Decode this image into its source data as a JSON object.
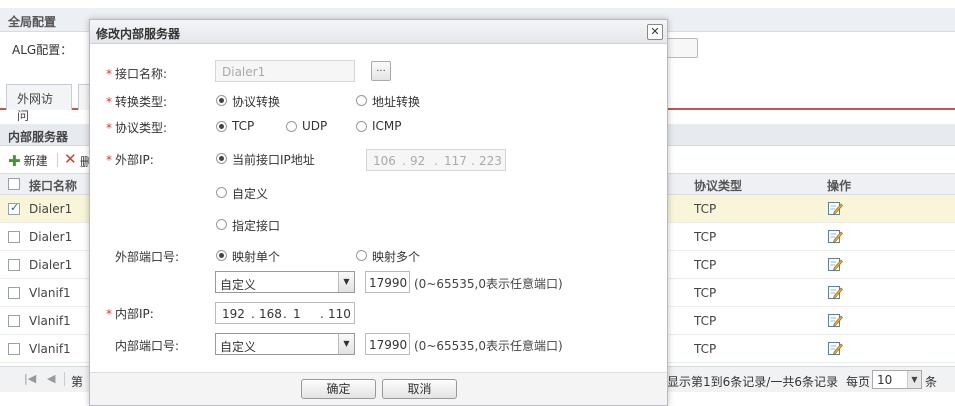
{
  "global": {
    "title": "全局配置",
    "alg_label": "ALG配置："
  },
  "tabs": [
    {
      "label": "外网访问"
    },
    {
      "label": ""
    }
  ],
  "panel": {
    "title": "内部服务器"
  },
  "toolbar": {
    "add_label": "新建",
    "delete_label": "删",
    "add_icon": "plus-icon",
    "delete_icon": "close-icon"
  },
  "table": {
    "headers": {
      "name": "接口名称",
      "protocol": "协议类型",
      "action": "操作"
    },
    "rows": [
      {
        "name": "Dialer1",
        "protocol": "TCP",
        "checked": true
      },
      {
        "name": "Dialer1",
        "protocol": "TCP",
        "checked": false
      },
      {
        "name": "Dialer1",
        "protocol": "TCP",
        "checked": false
      },
      {
        "name": "Vlanif1",
        "protocol": "TCP",
        "checked": false
      },
      {
        "name": "Vlanif1",
        "protocol": "TCP",
        "checked": false
      },
      {
        "name": "Vlanif1",
        "protocol": "TCP",
        "checked": false
      }
    ]
  },
  "pager": {
    "page_label": "第",
    "info": "显示第1到6条记录/一共6条记录",
    "per_page_label": "每页",
    "per_page_value": "10",
    "unit": "条"
  },
  "dialog": {
    "title": "修改内部服务器",
    "close_icon": "close-icon",
    "interface_name": {
      "label": "接口名称:",
      "placeholder": "Dialer1",
      "browse_label": "..."
    },
    "conversion_type": {
      "label": "转换类型:",
      "options": [
        {
          "label": "协议转换",
          "selected": true
        },
        {
          "label": "地址转换",
          "selected": false
        }
      ]
    },
    "protocol_type": {
      "label": "协议类型:",
      "options": [
        {
          "label": "TCP",
          "selected": true
        },
        {
          "label": "UDP",
          "selected": false
        },
        {
          "label": "ICMP",
          "selected": false
        }
      ]
    },
    "external_ip": {
      "label": "外部IP:",
      "options": [
        {
          "label": "当前接口IP地址",
          "selected": true
        },
        {
          "label": "自定义",
          "selected": false
        },
        {
          "label": "指定接口",
          "selected": false
        }
      ],
      "ip": [
        "106",
        "92",
        "117",
        "223"
      ]
    },
    "external_port": {
      "label": "外部端口号:",
      "options": [
        {
          "label": "映射单个",
          "selected": true
        },
        {
          "label": "映射多个",
          "selected": false
        }
      ],
      "select_value": "自定义",
      "port": "17990",
      "hint": "(0~65535,0表示任意端口)"
    },
    "internal_ip": {
      "label": "内部IP:",
      "ip": [
        "192",
        "168",
        "1",
        "110"
      ]
    },
    "internal_port": {
      "label": "内部端口号:",
      "select_value": "自定义",
      "port": "17990",
      "hint": "(0~65535,0表示任意端口)"
    },
    "buttons": {
      "ok": "确定",
      "cancel": "取消"
    }
  }
}
